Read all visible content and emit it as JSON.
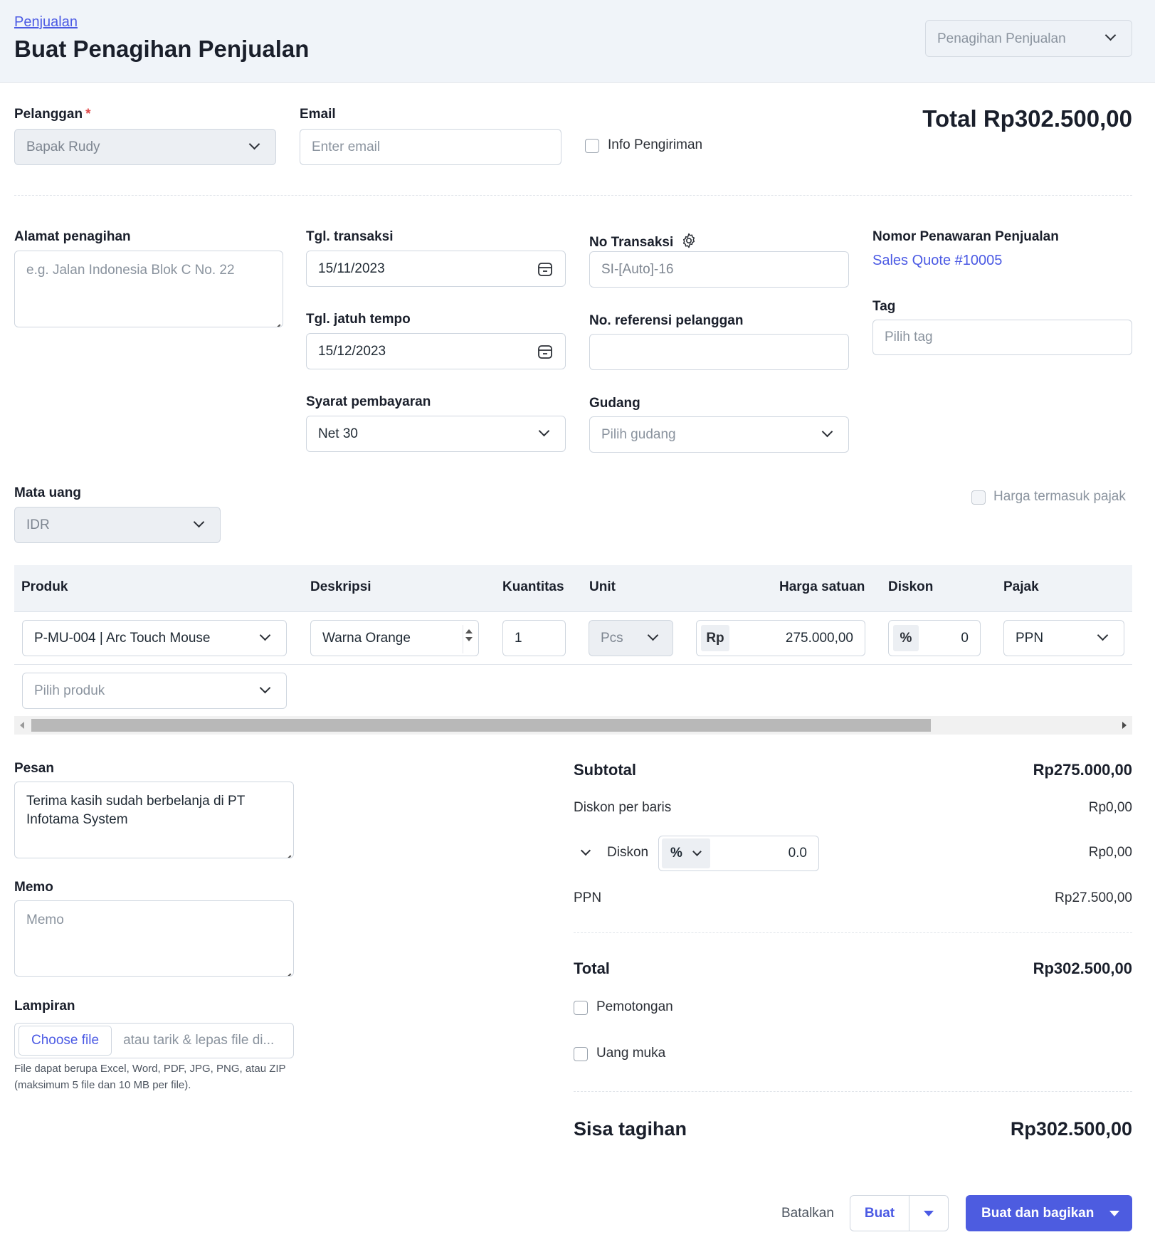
{
  "header": {
    "breadcrumb": "Penjualan",
    "title": "Buat Penagihan Penjualan",
    "doc_type": "Penagihan Penjualan"
  },
  "customer": {
    "label": "Pelanggan",
    "required_mark": "*",
    "value": "Bapak Rudy"
  },
  "email": {
    "label": "Email",
    "placeholder": "Enter email"
  },
  "shipping_info": {
    "label": "Info Pengiriman",
    "checked": false
  },
  "total_top": "Total Rp302.500,00",
  "billing_address": {
    "label": "Alamat penagihan",
    "placeholder": "e.g. Jalan Indonesia Blok C No. 22"
  },
  "transaction_date": {
    "label": "Tgl. transaksi",
    "value": "15/11/2023"
  },
  "due_date": {
    "label": "Tgl. jatuh tempo",
    "value": "15/12/2023"
  },
  "payment_terms": {
    "label": "Syarat pembayaran",
    "value": "Net 30"
  },
  "transaction_no": {
    "label": "No Transaksi",
    "value": "SI-[Auto]-16"
  },
  "customer_ref": {
    "label": "No. referensi pelanggan",
    "value": ""
  },
  "warehouse": {
    "label": "Gudang",
    "placeholder": "Pilih gudang"
  },
  "quote": {
    "label": "Nomor Penawaran Penjualan",
    "link": "Sales Quote #10005"
  },
  "tag": {
    "label": "Tag",
    "placeholder": "Pilih tag"
  },
  "currency": {
    "label": "Mata uang",
    "value": "IDR"
  },
  "price_incl_tax": {
    "label": "Harga termasuk pajak",
    "checked": false
  },
  "table": {
    "headers": [
      "Produk",
      "Deskripsi",
      "Kuantitas",
      "Unit",
      "Harga satuan",
      "Diskon",
      "Pajak"
    ],
    "rows": [
      {
        "product": "P-MU-004 | Arc Touch Mouse",
        "description": "Warna Orange",
        "quantity": "1",
        "unit": "Pcs",
        "price_prefix": "Rp",
        "price": "275.000,00",
        "discount_prefix": "%",
        "discount": "0",
        "tax": "PPN"
      }
    ],
    "add_product_placeholder": "Pilih produk"
  },
  "message": {
    "label": "Pesan",
    "value": "Terima kasih sudah berbelanja di PT Infotama System"
  },
  "memo": {
    "label": "Memo",
    "placeholder": "Memo"
  },
  "attachment": {
    "label": "Lampiran",
    "button": "Choose file",
    "drop_text": "atau tarik & lepas file di...",
    "hint": "File dapat berupa Excel, Word, PDF, JPG, PNG, atau ZIP (maksimum 5 file dan 10 MB per file)."
  },
  "summary": {
    "subtotal_label": "Subtotal",
    "subtotal": "Rp275.000,00",
    "line_discount_label": "Diskon per baris",
    "line_discount": "Rp0,00",
    "discount_label": "Diskon",
    "discount_type": "%",
    "discount_input": "0.0",
    "discount": "Rp0,00",
    "tax_label": "PPN",
    "tax": "Rp27.500,00",
    "total_label": "Total",
    "total": "Rp302.500,00",
    "withholding_label": "Pemotongan",
    "deposit_label": "Uang muka",
    "balance_label": "Sisa tagihan",
    "balance": "Rp302.500,00"
  },
  "actions": {
    "cancel": "Batalkan",
    "create": "Buat",
    "create_share": "Buat dan bagikan"
  },
  "colors": {
    "accent": "#4d5ce0",
    "link": "#4b5ae4",
    "header_bg": "#f0f4f9",
    "required": "#e04848"
  }
}
